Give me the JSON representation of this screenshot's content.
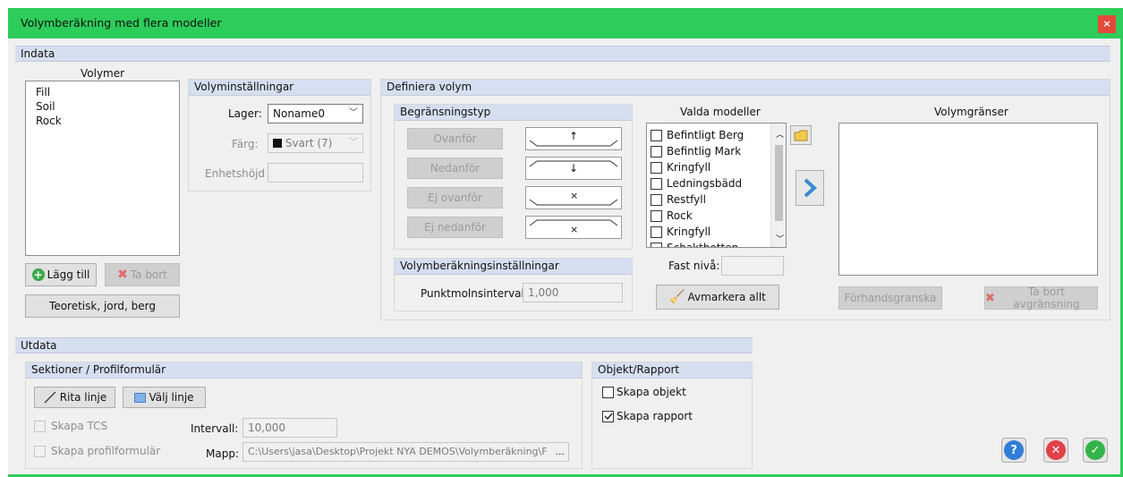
{
  "window": {
    "title": "Volymberäkning med flera modeller",
    "close": "×"
  },
  "indata": {
    "header": "Indata",
    "volumes": {
      "label": "Volymer",
      "items": [
        "Fill",
        "Soil",
        "Rock"
      ]
    },
    "add_button": "Lägg till",
    "remove_button": "Ta bort",
    "preset_button": "Teoretisk, jord, berg",
    "settings": {
      "header": "Volyminställningar",
      "layer_label": "Lager:",
      "layer_value": "Noname0",
      "color_label": "Färg:",
      "color_value": "Svart (7)",
      "unit_height_label": "Enhetshöjd",
      "unit_height_value": ""
    },
    "define": {
      "header": "Definiera volym",
      "boundary": {
        "header": "Begränsningstyp",
        "buttons": [
          "Ovanför",
          "Nedanför",
          "Ej ovanför",
          "Ej nedanför"
        ],
        "symbols": [
          "↑",
          "↓",
          "×",
          "×"
        ]
      },
      "calc_settings": {
        "header": "Volymberäkningsinställningar",
        "point_interval_label": "Punktmolnsintervall:",
        "point_interval_value": "1,000"
      },
      "models": {
        "label": "Valda modeller",
        "items": [
          "Befintligt Berg",
          "Befintlig Mark",
          "Kringfyll",
          "Ledningsbädd",
          "Restfyll",
          "Rock",
          "Kringfyll",
          "Schaktbotten"
        ],
        "fixed_level_label": "Fast nivå:",
        "fixed_level_value": "",
        "deselect_all": "Avmarkera allt"
      },
      "limits": {
        "label": "Volymgränser",
        "preview_button": "Förhandsgranska",
        "remove_limit_button": "Ta bort avgränsning"
      }
    }
  },
  "utdata": {
    "header": "Utdata",
    "sections": {
      "header": "Sektioner / Profilformulär",
      "draw_line": "Rita linje",
      "select_line": "Välj linje",
      "create_tcs": "Skapa TCS",
      "create_profile": "Skapa profilformulär",
      "interval_label": "Intervall:",
      "interval_value": "10,000",
      "folder_label": "Mapp:",
      "folder_value": "C:\\Users\\jasa\\Desktop\\Projekt NYA DEMOS\\Volymberäkning\\F",
      "browse": "..."
    },
    "object_report": {
      "header": "Objekt/Rapport",
      "create_object": "Skapa objekt",
      "create_object_checked": false,
      "create_report": "Skapa rapport",
      "create_report_checked": true
    }
  },
  "dialog_buttons": {
    "help": "?",
    "cancel": "✕",
    "ok": "✓"
  },
  "colors": {
    "title_bar": "#2ecc5a",
    "section_header": "#d6dff0",
    "help": "#2f7fd6",
    "cancel": "#e0414a",
    "ok": "#34b34a"
  }
}
